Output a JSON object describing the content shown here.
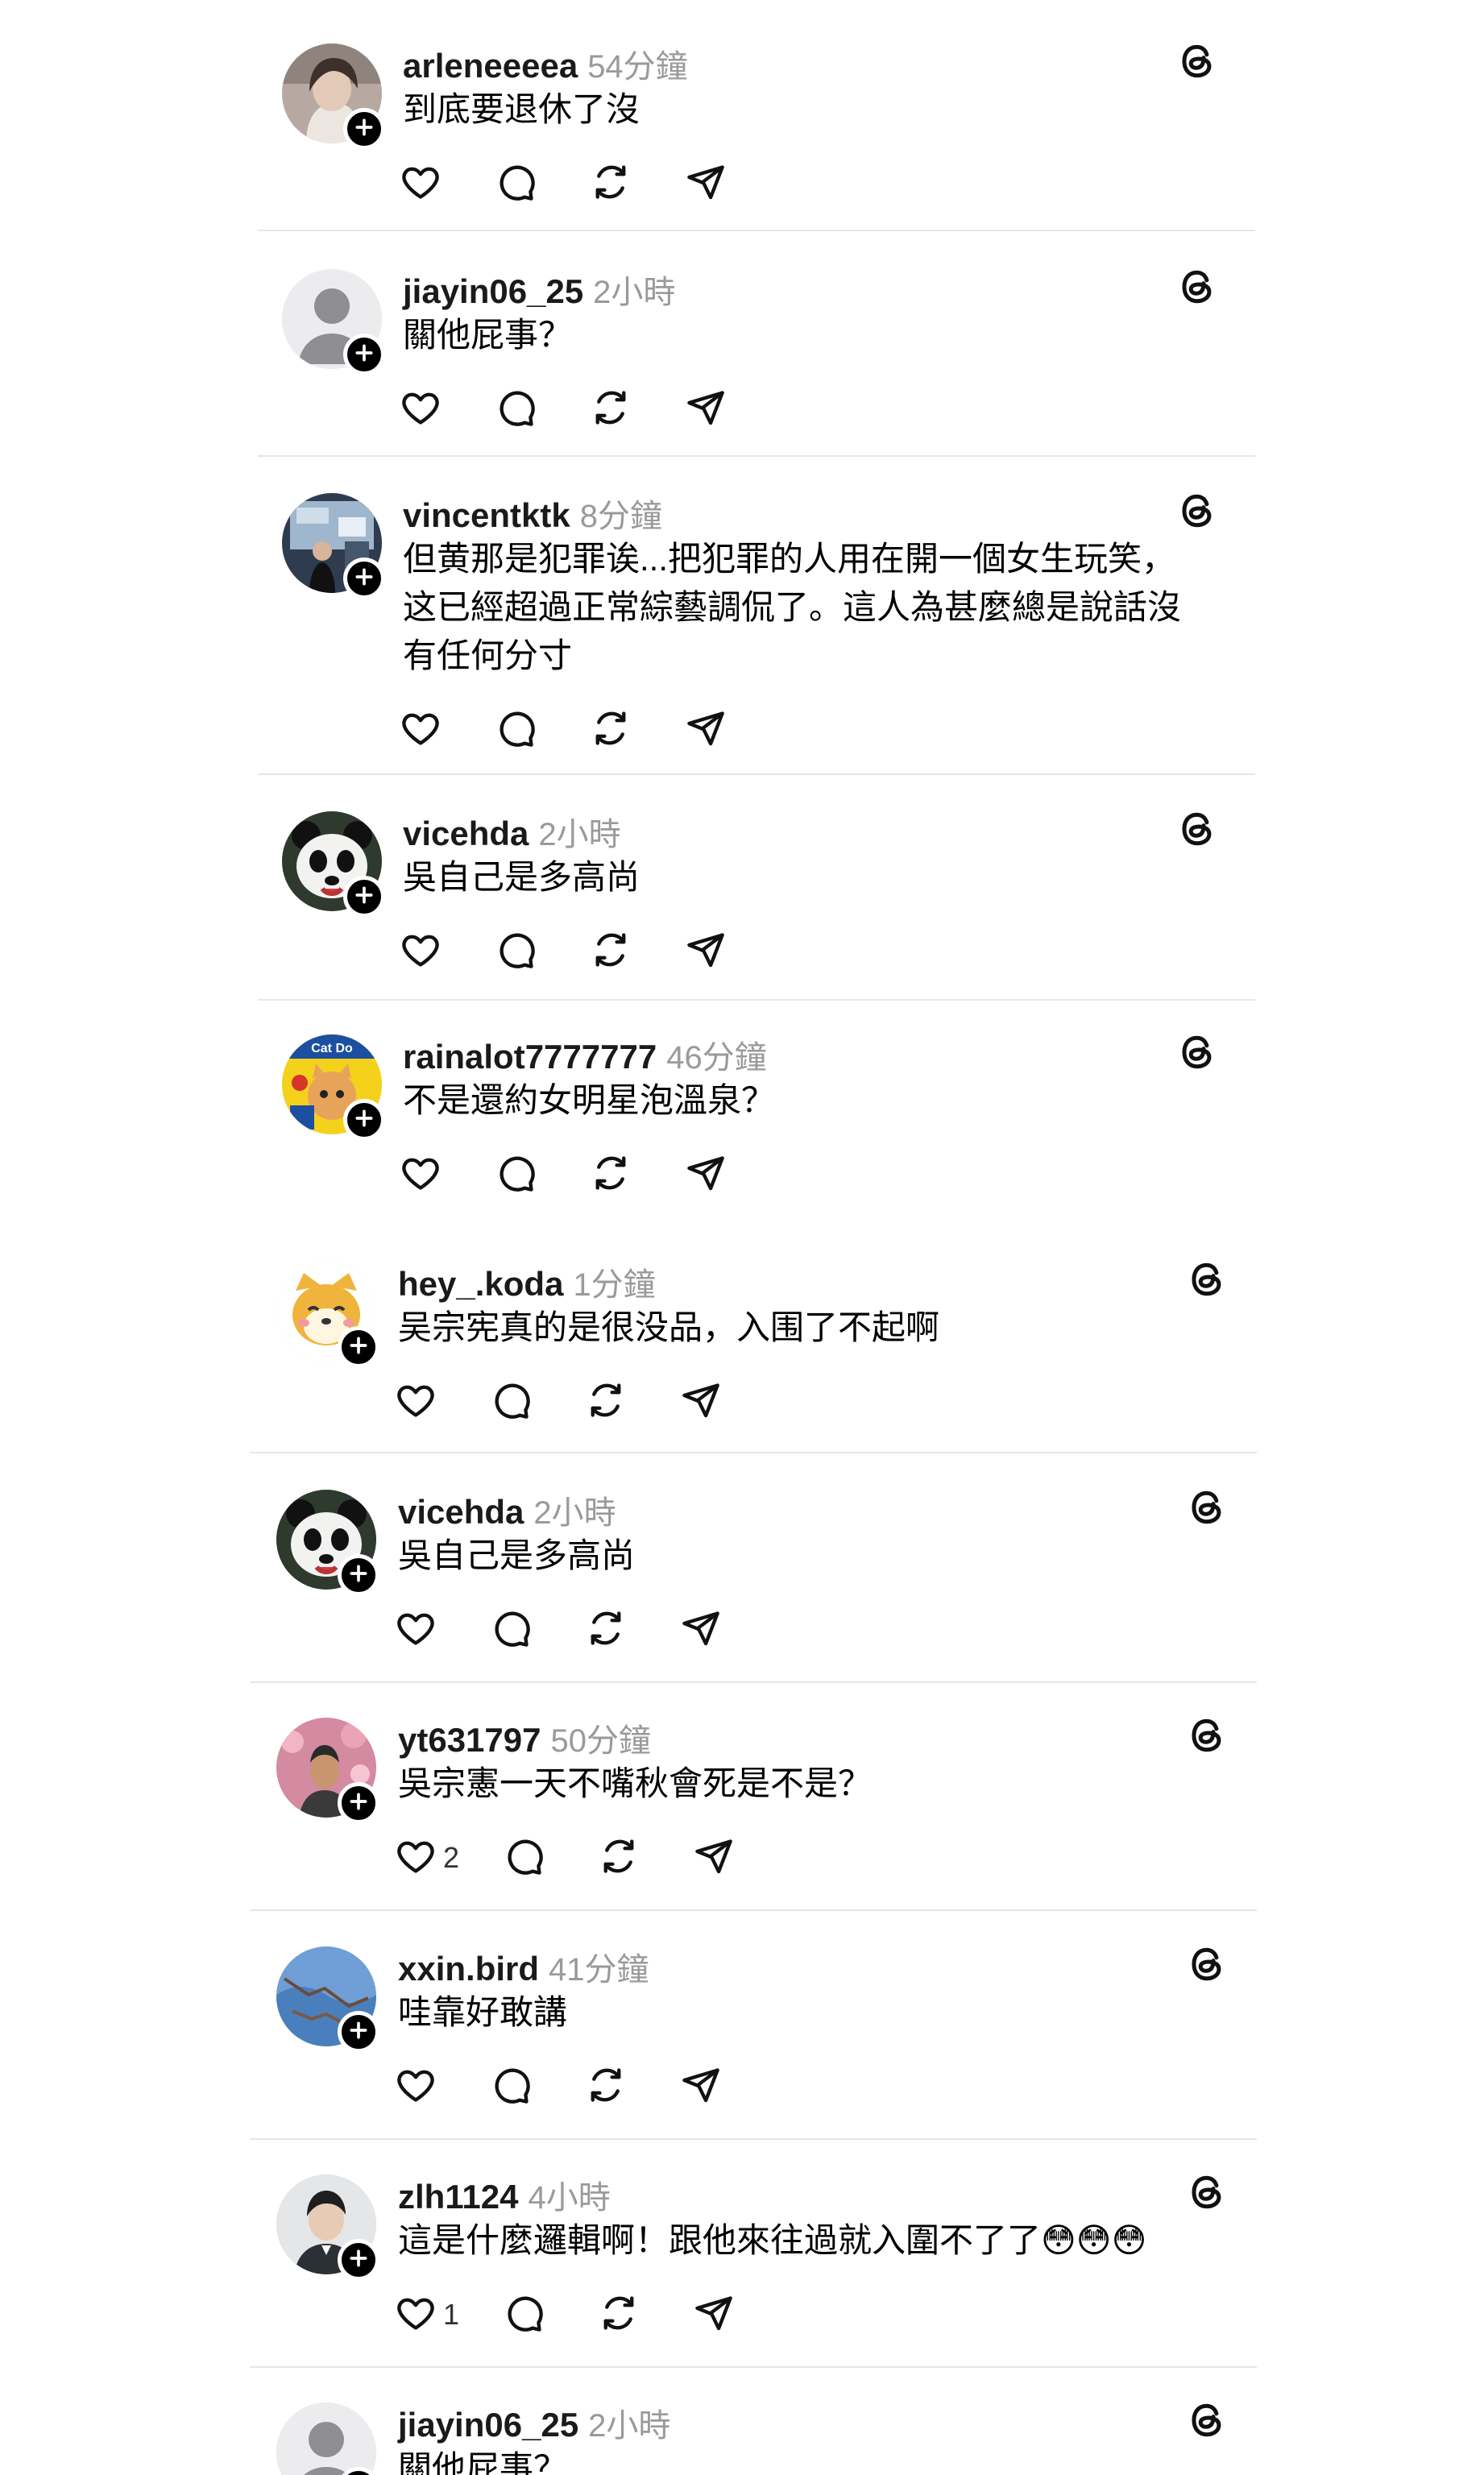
{
  "posts": [
    {
      "username": "arleneeeea",
      "time": "54分鐘",
      "text": "到底要退休了沒",
      "likes": "",
      "avatar": "photo-woman"
    },
    {
      "username": "jiayin06_25",
      "time": "2小時",
      "text": "關他屁事？",
      "likes": "",
      "avatar": "default-person"
    },
    {
      "username": "vincentktk",
      "time": "8分鐘",
      "text": "但黄那是犯罪诶...把犯罪的人用在開一個女生玩笑，这已經超過正常綜藝調侃了。這人為甚麼總是說話沒有任何分寸",
      "likes": "",
      "avatar": "photo-event"
    },
    {
      "username": "vicehda",
      "time": "2小時",
      "text": "吳自己是多高尚",
      "likes": "",
      "avatar": "panda"
    },
    {
      "username": "rainalot7777777",
      "time": "46分鐘",
      "text": "不是還約女明星泡溫泉？",
      "likes": "",
      "avatar": "cat-poster"
    },
    {
      "username": "hey_.koda",
      "time": "1分鐘",
      "text": "吴宗宪真的是很没品，入围了不起啊",
      "likes": "",
      "avatar": "shiba"
    },
    {
      "username": "vicehda",
      "time": "2小時",
      "text": "吳自己是多高尚",
      "likes": "",
      "avatar": "panda"
    },
    {
      "username": "yt631797",
      "time": "50分鐘",
      "text": "吳宗憲一天不嘴秋會死是不是？",
      "likes": "2",
      "avatar": "photo-man-flowers"
    },
    {
      "username": "xxin.bird",
      "time": "41分鐘",
      "text": "哇靠好敢講",
      "likes": "",
      "avatar": "photo-sky"
    },
    {
      "username": "zlh1124",
      "time": "4小時",
      "text": "這是什麼邏輯啊！跟他來往過就入圍不了了😳😳😳",
      "likes": "1",
      "avatar": "photo-man-suit"
    },
    {
      "username": "jiayin06_25",
      "time": "2小時",
      "text": "關他屁事？",
      "likes": "",
      "avatar": "default-person"
    }
  ],
  "icons": {
    "like": "heart-icon",
    "reply": "reply-bubble-icon",
    "repost": "repost-icon",
    "share": "share-send-icon",
    "threads": "threads-logo-icon",
    "follow": "plus-icon"
  }
}
